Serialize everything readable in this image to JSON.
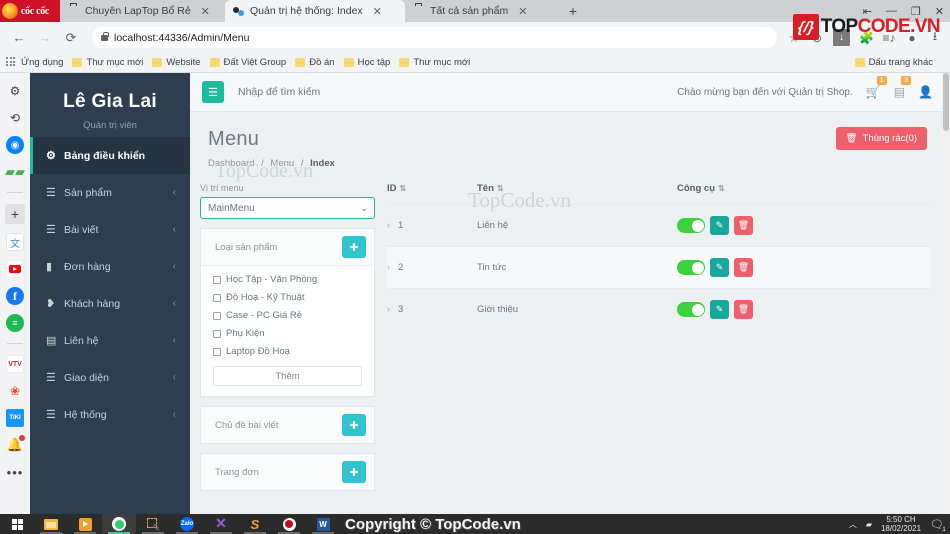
{
  "browser": {
    "brand_tab": "cốc cốc",
    "tabs": [
      {
        "title": "Chuyên LapTop Bổ Rẻ",
        "icon": "briefcase-icon",
        "active": false
      },
      {
        "title": "Quản trị hệ thống: Index",
        "icon": "admin-icon",
        "active": true
      },
      {
        "title": "Tất cả sản phẩm",
        "icon": "briefcase-icon",
        "active": false
      }
    ],
    "new_tab_label": "+",
    "window_controls": [
      "⇤",
      "—",
      "❐",
      "✕"
    ],
    "nav": {
      "back": "←",
      "forward": "→",
      "reload": "⟳"
    },
    "url": "localhost:44336/Admin/Menu",
    "toolbar_icons": [
      "star-icon",
      "shield-icon",
      "download-icon",
      "extension-icon",
      "playlist-icon",
      "profile-icon",
      "downloads-icon"
    ],
    "bookmarks": [
      {
        "label": "Ứng dụng",
        "icon": "apps-grid-icon"
      },
      {
        "label": "Thư mục mới",
        "icon": "folder-icon"
      },
      {
        "label": "Website",
        "icon": "folder-icon"
      },
      {
        "label": "Đất Việt Group",
        "icon": "folder-icon"
      },
      {
        "label": "Đồ án",
        "icon": "folder-icon"
      },
      {
        "label": "Học tập",
        "icon": "folder-icon"
      },
      {
        "label": "Thư mục mới",
        "icon": "folder-icon"
      }
    ],
    "other_bookmarks": "Dấu trang khác"
  },
  "watermark_logo": {
    "left": "{/}",
    "text_dark": "TOP",
    "text_red": "CODE.VN"
  },
  "rail": {
    "items": [
      {
        "name": "gear-icon",
        "glyph": "⚙"
      },
      {
        "name": "history-icon",
        "glyph": "⟲"
      },
      {
        "name": "messenger-icon",
        "glyph": "⚡"
      },
      {
        "name": "game-icon",
        "glyph": "🎮"
      },
      {
        "name": "add-icon",
        "glyph": "+"
      },
      {
        "name": "translate-icon",
        "glyph": "文"
      },
      {
        "name": "youtube-icon",
        "glyph": ""
      },
      {
        "name": "facebook-icon",
        "glyph": "f"
      },
      {
        "name": "spotify-icon",
        "glyph": "≡"
      },
      {
        "name": "vtv-icon",
        "glyph": "VTV"
      },
      {
        "name": "shopee-icon",
        "glyph": "🛍"
      },
      {
        "name": "tiki-icon",
        "glyph": "TIKI"
      },
      {
        "name": "bell-icon",
        "glyph": "🔔"
      },
      {
        "name": "more-icon",
        "glyph": "•••"
      }
    ]
  },
  "sidebar": {
    "brand_name": "Lê Gia Lai",
    "brand_role": "Quản trị viên",
    "items": [
      {
        "label": "Bảng điều khiển",
        "icon": "dashboard-icon",
        "glyph": "⚙",
        "active": true,
        "caret": ""
      },
      {
        "label": "Sản phẩm",
        "icon": "list-icon",
        "glyph": "☰",
        "active": false,
        "caret": "‹"
      },
      {
        "label": "Bài viết",
        "icon": "list-icon",
        "glyph": "☰",
        "active": false,
        "caret": "‹"
      },
      {
        "label": "Đơn hàng",
        "icon": "bag-icon",
        "glyph": "🛍",
        "active": false,
        "caret": "‹"
      },
      {
        "label": "Khách hàng",
        "icon": "users-icon",
        "glyph": "👥",
        "active": false,
        "caret": "‹"
      },
      {
        "label": "Liên hệ",
        "icon": "card-icon",
        "glyph": "▤",
        "active": false,
        "caret": "‹"
      },
      {
        "label": "Giao diện",
        "icon": "list-icon",
        "glyph": "☰",
        "active": false,
        "caret": "‹"
      },
      {
        "label": "Hệ thống",
        "icon": "list-icon",
        "glyph": "☰",
        "active": false,
        "caret": "‹"
      }
    ]
  },
  "topbar": {
    "menu_toggle_icon": "hamburger-icon",
    "search_placeholder": "Nhập để tìm kiếm",
    "welcome": "Chào mừng bạn đến với Quản trị Shop.",
    "cart_badge": "1",
    "mail_badge": "3"
  },
  "page": {
    "title": "Menu",
    "breadcrumb": [
      "Dashboard",
      "Menu",
      "Index"
    ],
    "trash_button": "Thùng rác(0)"
  },
  "panel": {
    "position_label": "Vị trí menu",
    "position_value": "MainMenu",
    "position_options": [
      "MainMenu"
    ],
    "groups": [
      {
        "title": "Loại sản phẩm",
        "expanded": true,
        "checkboxes": [
          "Học Tập - Văn Phòng",
          "Đồ Hoạ - Kỹ Thuật",
          "Case - PC Giá Rẻ",
          "Phụ Kiện",
          "Laptop Đồ Hoạ"
        ],
        "add_label": "Thêm"
      },
      {
        "title": "Chủ đề bài viết",
        "expanded": false,
        "checkboxes": [],
        "add_label": ""
      },
      {
        "title": "Trang đơn",
        "expanded": false,
        "checkboxes": [],
        "add_label": ""
      }
    ]
  },
  "table": {
    "columns": [
      "ID",
      "Tên",
      "Công cụ"
    ],
    "rows": [
      {
        "id": "1",
        "name": "Liên hệ",
        "enabled": true
      },
      {
        "id": "2",
        "name": "Tin tức",
        "enabled": true
      },
      {
        "id": "3",
        "name": "Giới thiệu",
        "enabled": true
      }
    ]
  },
  "watermarks": {
    "content_1": "TopCode.vn",
    "content_2": "TopCode.vn",
    "footer": "Copyright © TopCode.vn"
  },
  "taskbar": {
    "apps": [
      {
        "name": "file-explorer-icon"
      },
      {
        "name": "media-player-icon"
      },
      {
        "name": "coccoc-browser-icon"
      },
      {
        "name": "dev-tools-icon"
      },
      {
        "name": "zalo-icon"
      },
      {
        "name": "visual-studio-icon"
      },
      {
        "name": "subtitle-edit-icon"
      },
      {
        "name": "recorder-icon"
      },
      {
        "name": "word-icon"
      }
    ],
    "tray": {
      "time": "5:50 CH",
      "date": "18/02/2021",
      "notif_count": "1"
    }
  },
  "colors": {
    "sidebar_bg": "#2c3e50",
    "accent_teal": "#1abc9c",
    "danger_red": "#ef5f6b",
    "toggle_green": "#3ed13e",
    "link_blue": "#4a90c4"
  }
}
